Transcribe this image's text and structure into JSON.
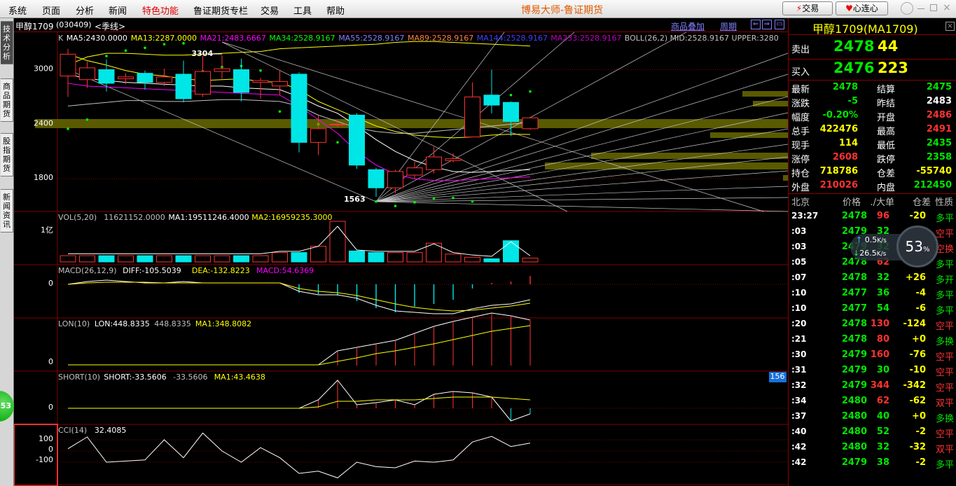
{
  "menu": [
    "系统",
    "页面",
    "分析",
    "新闻",
    "特色功能",
    "鲁证期货专栏",
    "交易",
    "工具",
    "帮助"
  ],
  "app_title": "博易大师-鲁证期货",
  "toolbar": {
    "trade": "交易",
    "heart": "心连心"
  },
  "left_tabs": [
    "技术分析",
    "商品期货",
    "股指期货",
    "新闻资讯"
  ],
  "side_badge": "53",
  "chart_header": {
    "symbol": "甲醇1709",
    "code": "(030409)",
    "period": "<季线>",
    "overlay": "商品叠加",
    "cycle": "周期"
  },
  "indicator_rows": {
    "main": [
      {
        "t": "K",
        "c": "#c0c0c0"
      },
      {
        "t": "MA5:2430.0000",
        "c": "#ffffff"
      },
      {
        "t": "MA13:2287.0000",
        "c": "#ffff00"
      },
      {
        "t": "MA21:2483.6667",
        "c": "#ff00ff"
      },
      {
        "t": "MA34:2528.9167",
        "c": "#00ff00"
      },
      {
        "t": "MA55:2528.9167",
        "c": "#8080ff"
      },
      {
        "t": "MA89:2528.9167",
        "c": "#ff8040"
      },
      {
        "t": "MA144:2528.9167",
        "c": "#4040ff"
      },
      {
        "t": "MA233:2528.9167",
        "c": "#c000c0"
      },
      {
        "t": "BOLL(26,2) MID:2528.9167 UPPER:3280",
        "c": "#c0c0c0"
      }
    ],
    "vol": [
      {
        "t": "VOL(5,20)",
        "c": "#c0c0c0"
      },
      {
        "t": "11621152.0000",
        "c": "#c0c0c0"
      },
      {
        "t": "MA1:19511246.4000",
        "c": "#ffffff"
      },
      {
        "t": "MA2:16959235.3000",
        "c": "#ffff00"
      }
    ],
    "macd": [
      {
        "t": "MACD(26,12,9)",
        "c": "#c0c0c0"
      },
      {
        "t": "DIFF:-105.5039",
        "c": "#ffffff"
      },
      {
        "t": "DEA:-132.8223",
        "c": "#ffff00"
      },
      {
        "t": "MACD:54.6369",
        "c": "#ff00ff"
      }
    ],
    "lon": [
      {
        "t": "LON(10)",
        "c": "#c0c0c0"
      },
      {
        "t": "LON:448.8335",
        "c": "#ffffff"
      },
      {
        "t": "448.8335",
        "c": "#c0c0c0"
      },
      {
        "t": "MA1:348.8082",
        "c": "#ffff00"
      }
    ],
    "short": [
      {
        "t": "SHORT(10)",
        "c": "#c0c0c0"
      },
      {
        "t": "SHORT:-33.5606",
        "c": "#ffffff"
      },
      {
        "t": "-33.5606",
        "c": "#c0c0c0"
      },
      {
        "t": "MA1:43.4638",
        "c": "#ffff00"
      }
    ],
    "cci": [
      {
        "t": "CCI(14)",
        "c": "#c0c0c0"
      },
      {
        "t": "32.4085",
        "c": "#ffffff"
      }
    ]
  },
  "axis_labels": {
    "main": [
      "3000",
      "2400",
      "1800"
    ],
    "vol": [
      "1亿"
    ],
    "macd": [
      "0"
    ],
    "lon": [
      "0"
    ],
    "short": [
      "0"
    ],
    "cci": [
      "100",
      "0",
      "-100"
    ]
  },
  "annotations": {
    "high": "3304",
    "low": "1563",
    "scroll_value": "156"
  },
  "chart_data": {
    "type": "candlestick",
    "y_range": [
      1563,
      3304
    ],
    "candles": [
      {
        "o": 2930,
        "c": 3170,
        "h": 3230,
        "l": 2700
      },
      {
        "o": 2890,
        "c": 3020,
        "h": 3090,
        "l": 2800
      },
      {
        "o": 3000,
        "c": 2850,
        "h": 3110,
        "l": 2760
      },
      {
        "o": 2900,
        "c": 2920,
        "h": 2960,
        "l": 2840
      },
      {
        "o": 2960,
        "c": 2860,
        "h": 2990,
        "l": 2780
      },
      {
        "o": 2860,
        "c": 2920,
        "h": 3010,
        "l": 2820
      },
      {
        "o": 2950,
        "c": 2680,
        "h": 3100,
        "l": 2640
      },
      {
        "o": 2730,
        "c": 2980,
        "h": 3150,
        "l": 2700
      },
      {
        "o": 2980,
        "c": 3010,
        "h": 3160,
        "l": 2900
      },
      {
        "o": 3000,
        "c": 2750,
        "h": 3120,
        "l": 2650
      },
      {
        "o": 2860,
        "c": 2880,
        "h": 2910,
        "l": 2680
      },
      {
        "o": 2820,
        "c": 2870,
        "h": 2990,
        "l": 2720
      },
      {
        "o": 2950,
        "c": 2200,
        "h": 2970,
        "l": 2090
      },
      {
        "o": 2200,
        "c": 2350,
        "h": 2500,
        "l": 2060
      },
      {
        "o": 2400,
        "c": 2400,
        "h": 2440,
        "l": 2370
      },
      {
        "o": 2500,
        "c": 1950,
        "h": 2520,
        "l": 1910
      },
      {
        "o": 1900,
        "c": 1700,
        "h": 1920,
        "l": 1600
      },
      {
        "o": 1700,
        "c": 1880,
        "h": 1900,
        "l": 1640
      },
      {
        "o": 1840,
        "c": 1920,
        "h": 1990,
        "l": 1800
      },
      {
        "o": 1900,
        "c": 2040,
        "h": 2150,
        "l": 1860
      },
      {
        "o": 2000,
        "c": 2020,
        "h": 2080,
        "l": 1980
      },
      {
        "o": 2260,
        "c": 2700,
        "h": 2860,
        "l": 2260
      },
      {
        "o": 2720,
        "c": 2610,
        "h": 3000,
        "l": 2520
      },
      {
        "o": 2640,
        "c": 2430,
        "h": 2650,
        "l": 2270
      },
      {
        "o": 2350,
        "c": 2470,
        "h": 2480,
        "l": 2340
      }
    ],
    "volume": [
      0.2,
      0.2,
      0.2,
      0.2,
      0.2,
      0.2,
      0.2,
      0.2,
      0.2,
      0.2,
      0.2,
      0.3,
      0.3,
      0.5,
      1.3,
      0.35,
      0.3,
      0.3,
      0.3,
      0.6,
      0.25,
      0.15,
      0.1,
      0.68,
      0.12
    ],
    "cci": [
      20,
      125,
      -100,
      -90,
      -80,
      100,
      -60,
      160,
      0,
      -100,
      30,
      -60,
      -200,
      -180,
      -240,
      -100,
      -140,
      -150,
      -90,
      -100,
      -80,
      80,
      130,
      40,
      70
    ]
  },
  "quote": {
    "title": "甲醇1709(MA1709)",
    "sell": {
      "label": "卖出",
      "price": "2478",
      "vol": "44"
    },
    "buy": {
      "label": "买入",
      "price": "2476",
      "vol": "223"
    },
    "stats": [
      [
        {
          "t": "最新",
          "c": "wht"
        },
        {
          "t": "2478",
          "c": "grn"
        },
        {
          "t": "结算",
          "c": "wht"
        },
        {
          "t": "2475",
          "c": "grn"
        }
      ],
      [
        {
          "t": "涨跌",
          "c": "wht"
        },
        {
          "t": "-5",
          "c": "grn"
        },
        {
          "t": "昨结",
          "c": "wht"
        },
        {
          "t": "2483",
          "c": "wht"
        }
      ],
      [
        {
          "t": "幅度",
          "c": "wht"
        },
        {
          "t": "-0.20%",
          "c": "grn"
        },
        {
          "t": "开盘",
          "c": "wht"
        },
        {
          "t": "2486",
          "c": "red"
        }
      ],
      [
        {
          "t": "总手",
          "c": "wht"
        },
        {
          "t": "422476",
          "c": "yel"
        },
        {
          "t": "最高",
          "c": "wht"
        },
        {
          "t": "2491",
          "c": "red"
        }
      ],
      [
        {
          "t": "现手",
          "c": "wht"
        },
        {
          "t": "114",
          "c": "yel"
        },
        {
          "t": "最低",
          "c": "wht"
        },
        {
          "t": "2435",
          "c": "grn"
        }
      ],
      [
        {
          "t": "涨停",
          "c": "wht"
        },
        {
          "t": "2608",
          "c": "red"
        },
        {
          "t": "跌停",
          "c": "wht"
        },
        {
          "t": "2358",
          "c": "grn"
        }
      ],
      [
        {
          "t": "持仓",
          "c": "wht"
        },
        {
          "t": "718786",
          "c": "yel"
        },
        {
          "t": "仓差",
          "c": "wht"
        },
        {
          "t": "-55740",
          "c": "yel"
        }
      ],
      [
        {
          "t": "外盘",
          "c": "wht"
        },
        {
          "t": "210026",
          "c": "red"
        },
        {
          "t": "内盘",
          "c": "wht"
        },
        {
          "t": "212450",
          "c": "grn"
        }
      ]
    ],
    "tick_headers": [
      "北京",
      "价格",
      "./大单",
      "仓差",
      "性质"
    ],
    "ticks": [
      {
        "time": "23:27",
        "price": "2478",
        "vol": "96",
        "chg": "-20",
        "type": "多平"
      },
      {
        "time": ":03",
        "price": "2479",
        "vol": "32",
        "chg": "-26",
        "type": "空平"
      },
      {
        "time": ":03",
        "price": "2479",
        "vol": "32",
        "chg": "-2",
        "type": "空换"
      },
      {
        "time": ":05",
        "price": "2478",
        "vol": "62",
        "chg": "-4",
        "type": "多平"
      },
      {
        "time": ":07",
        "price": "2478",
        "vol": "32",
        "chg": "+26",
        "type": "多开"
      },
      {
        "time": ":10",
        "price": "2477",
        "vol": "36",
        "chg": "-4",
        "type": "多平"
      },
      {
        "time": ":10",
        "price": "2477",
        "vol": "54",
        "chg": "-6",
        "type": "多平"
      },
      {
        "time": ":20",
        "price": "2478",
        "vol": "130",
        "chg": "-124",
        "type": "空平"
      },
      {
        "time": ":21",
        "price": "2478",
        "vol": "80",
        "chg": "+0",
        "type": "多换"
      },
      {
        "time": ":30",
        "price": "2479",
        "vol": "160",
        "chg": "-76",
        "type": "空平"
      },
      {
        "time": ":31",
        "price": "2479",
        "vol": "30",
        "chg": "-10",
        "type": "空平"
      },
      {
        "time": ":32",
        "price": "2479",
        "vol": "344",
        "chg": "-342",
        "type": "空平"
      },
      {
        "time": ":34",
        "price": "2480",
        "vol": "62",
        "chg": "-62",
        "type": "双平"
      },
      {
        "time": ":37",
        "price": "2480",
        "vol": "40",
        "chg": "+0",
        "type": "多换"
      },
      {
        "time": ":40",
        "price": "2480",
        "vol": "52",
        "chg": "-2",
        "type": "空平"
      },
      {
        "time": ":42",
        "price": "2480",
        "vol": "32",
        "chg": "-32",
        "type": "双平"
      },
      {
        "time": ":42",
        "price": "2479",
        "vol": "38",
        "chg": "-2",
        "type": "多平"
      }
    ]
  },
  "network": {
    "up": "0.5",
    "down": "26.5",
    "unit": "K/s",
    "percent": "53",
    "pct_sign": "%"
  },
  "colors": {
    "up": "#ff3232",
    "down": "#00e6e6",
    "grid": "#800000",
    "fill": "#5a5a00"
  }
}
